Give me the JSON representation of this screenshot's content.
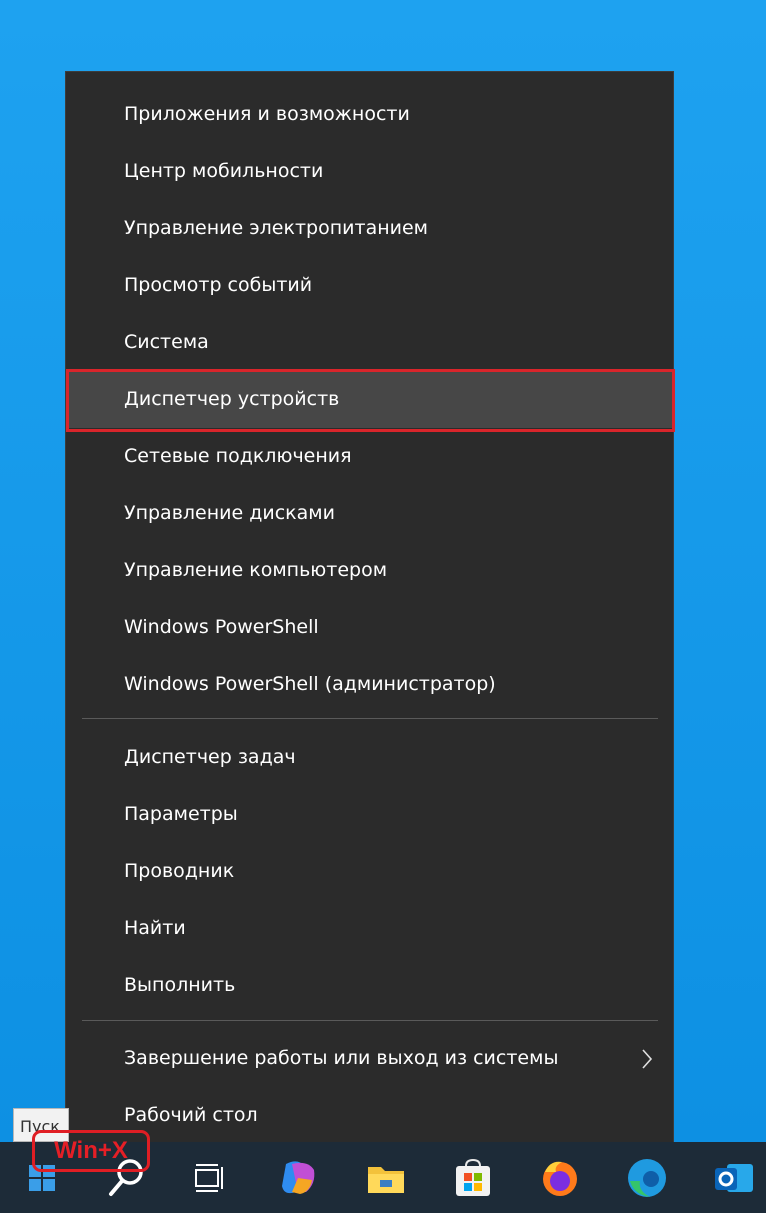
{
  "menu": {
    "items": [
      {
        "label": "Приложения и возможности"
      },
      {
        "label": "Центр мобильности"
      },
      {
        "label": "Управление электропитанием"
      },
      {
        "label": "Просмотр событий"
      },
      {
        "label": "Система"
      },
      {
        "label": "Диспетчер устройств"
      },
      {
        "label": "Сетевые подключения"
      },
      {
        "label": "Управление дисками"
      },
      {
        "label": "Управление компьютером"
      },
      {
        "label": "Windows PowerShell"
      },
      {
        "label": "Windows PowerShell (администратор)"
      },
      {
        "label": "Диспетчер задач"
      },
      {
        "label": "Параметры"
      },
      {
        "label": "Проводник"
      },
      {
        "label": "Найти"
      },
      {
        "label": "Выполнить"
      },
      {
        "label": "Завершение работы или выход из системы"
      },
      {
        "label": "Рабочий стол"
      }
    ]
  },
  "tooltip": {
    "text": "Пуск"
  },
  "annotation": {
    "shortcut": "Win+X"
  },
  "colors": {
    "menu_bg": "#2b2b2b",
    "highlight": "#d9252b",
    "desktop": "#0f8fe1",
    "taskbar": "#1d2b38"
  }
}
